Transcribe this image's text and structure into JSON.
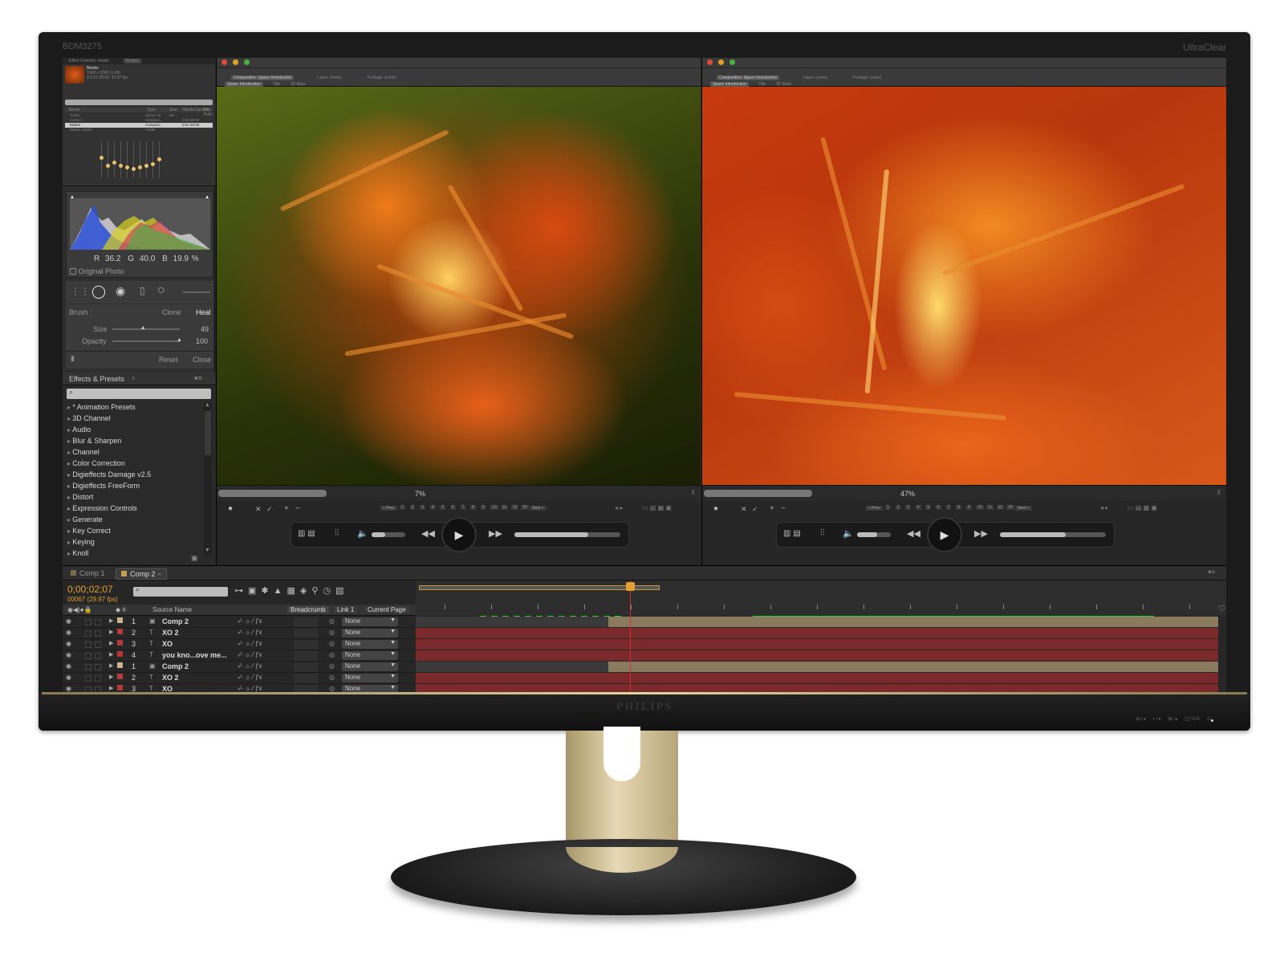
{
  "monitor": {
    "model": "BDM3275",
    "series": "UltraClear",
    "brand": "PHILIPS"
  },
  "left_panel": {
    "project_tabs": [
      "Effect Controls: masks",
      "Project"
    ],
    "project_item": {
      "name": "Masks",
      "line2": "1920 x 1080 (1.00)",
      "line3": "Δ 0:01:30:00, 29.97 fps"
    },
    "project_columns": [
      "Name",
      "Type",
      "Size",
      "Media Duration",
      "File Path"
    ],
    "project_rows": [
      {
        "name": "Comp",
        "type": "Vector Art",
        "size": "...KB",
        "duration": ""
      },
      {
        "name": "Comp 1",
        "type": "Composi...",
        "size": "",
        "duration": "0:01:30:00"
      },
      {
        "name": "Masks",
        "type": "Composi...",
        "size": "",
        "duration": "0:01:30:00"
      },
      {
        "name": "Masks Layers",
        "type": "Folder",
        "size": "",
        "duration": ""
      }
    ],
    "histogram": {
      "r_label": "R",
      "r": "36.2",
      "g_label": "G",
      "g": "40.0",
      "b_label": "B",
      "b": "19.9",
      "unit": "%",
      "original_photo": "Original Photo"
    },
    "brush": {
      "label": "Brush :",
      "clone": "Clone",
      "heal": "Heal",
      "size_label": "Size",
      "size": "49",
      "size_pct": 0.45,
      "opacity_label": "Opacity",
      "opacity": "100",
      "opacity_pct": 1.0,
      "reset": "Reset",
      "close": "Close"
    },
    "effects": {
      "title": "Effects & Presets",
      "search_placeholder": "",
      "items": [
        "* Animation Presets",
        "3D Channel",
        "Audio",
        "Blur & Sharpen",
        "Channel",
        "Color Correction",
        "Digieffects Damage v2.5",
        "Digieffects FreeForm",
        "Distort",
        "Expression Controls",
        "Generate",
        "Key Correct",
        "Keying",
        "Knoll"
      ]
    }
  },
  "viewer_left": {
    "tab": "Composition: Space Introduction",
    "layer": "Layer: (none)",
    "footage": "Footage: (none)",
    "breadcrumb": [
      "Space Introduction",
      "Title",
      "3D Back"
    ],
    "zoom": "7%",
    "zoom_frac": 0.07,
    "nav_prev": "< Prev",
    "nav_next": "Next >",
    "pages": [
      "1",
      "2",
      "3",
      "4",
      "5",
      "6",
      "7",
      "8",
      "9",
      "10",
      "11",
      "12",
      "25"
    ],
    "volume_frac": 0.4,
    "progress_frac": 0.7
  },
  "viewer_right": {
    "tab": "Composition: Space Introduction",
    "layer": "Layer: (none)",
    "footage": "Footage: (none)",
    "breadcrumb": [
      "Space Introduction",
      "Title",
      "3D Back"
    ],
    "zoom": "47%",
    "zoom_frac": 0.47,
    "nav_prev": "< Prev",
    "nav_next": "Next >",
    "pages": [
      "1",
      "2",
      "3",
      "4",
      "5",
      "6",
      "7",
      "8",
      "9",
      "10",
      "11",
      "12",
      "25"
    ],
    "volume_frac": 0.6,
    "progress_frac": 0.62
  },
  "timeline": {
    "tabs": [
      "Comp 1",
      "Comp 2"
    ],
    "active_tab": "Comp 2",
    "timecode": "0;00;02;07",
    "frame_info": "00067 (29.97 fps)",
    "columns": {
      "source_name": "Source Name",
      "breadcrumb": "Breadcrumb",
      "link": "Link 1",
      "current_page": "Current Page"
    },
    "layers": [
      {
        "num": "1",
        "name": "Comp 2",
        "parent": "None",
        "color": "#c8b48a",
        "kind": "comp"
      },
      {
        "num": "2",
        "name": "XO 2",
        "parent": "None",
        "color": "#b83838",
        "kind": "text"
      },
      {
        "num": "3",
        "name": "XO",
        "parent": "None",
        "color": "#b83838",
        "kind": "text"
      },
      {
        "num": "4",
        "name": "you kno...ove me...",
        "parent": "None",
        "color": "#b83838",
        "kind": "text"
      },
      {
        "num": "1",
        "name": "Comp 2",
        "parent": "None",
        "color": "#c8b48a",
        "kind": "comp"
      },
      {
        "num": "2",
        "name": "XO 2",
        "parent": "None",
        "color": "#b83838",
        "kind": "text"
      },
      {
        "num": "3",
        "name": "XO",
        "parent": "None",
        "color": "#b83838",
        "kind": "text"
      }
    ],
    "colors": {
      "comp_bar": "#8a7a5e",
      "text_bar": "#7a2a2a",
      "timecode": "#e0a030",
      "playhead": "#d23030"
    }
  }
}
